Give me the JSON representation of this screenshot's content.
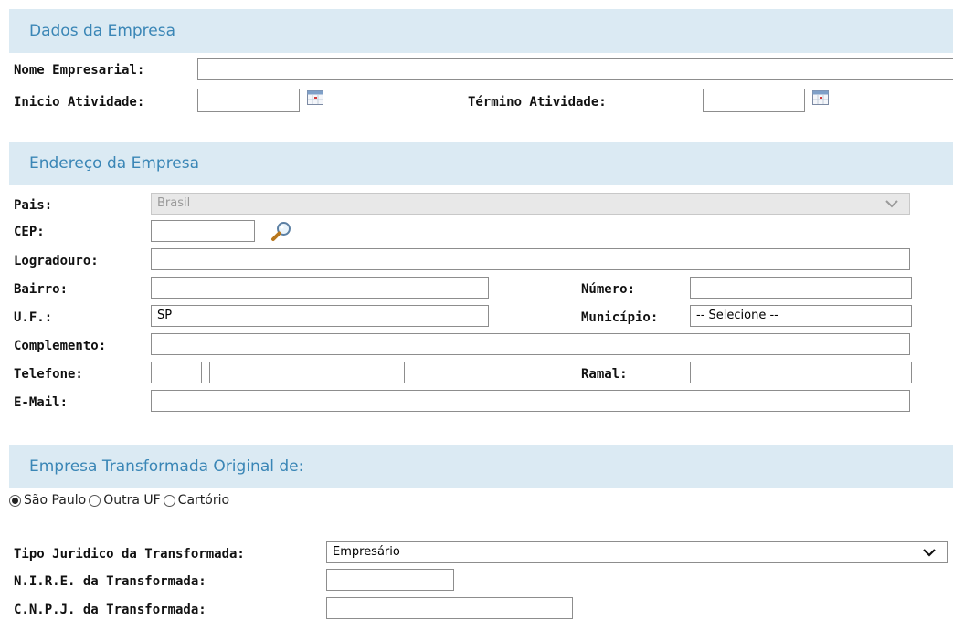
{
  "dados_empresa": {
    "header": "Dados da Empresa",
    "nome_label": "Nome Empresarial:",
    "nome_value": "",
    "inicio_label": "Inicio Atividade:",
    "inicio_value": "",
    "termino_label": "Término Atividade:",
    "termino_value": ""
  },
  "endereco": {
    "header": "Endereço da Empresa",
    "pais_label": "Pais:",
    "pais_value": "Brasil",
    "cep_label": "CEP:",
    "cep_value": "",
    "logradouro_label": "Logradouro:",
    "logradouro_value": "",
    "bairro_label": "Bairro:",
    "bairro_value": "",
    "numero_label": "Número:",
    "numero_value": "",
    "uf_label": "U.F.:",
    "uf_value": "SP",
    "municipio_label": "Município:",
    "municipio_value": "-- Selecione --",
    "complemento_label": "Complemento:",
    "complemento_value": "",
    "telefone_label": "Telefone:",
    "telefone_ddd": "",
    "telefone_numero": "",
    "ramal_label": "Ramal:",
    "ramal_value": "",
    "email_label": "E-Mail:",
    "email_value": ""
  },
  "transformada": {
    "header": "Empresa Transformada Original de:",
    "radio_options": [
      {
        "label": "São Paulo",
        "checked": true
      },
      {
        "label": "Outra UF",
        "checked": false
      },
      {
        "label": "Cartório",
        "checked": false
      }
    ],
    "tipo_label": "Tipo Juridico da Transformada:",
    "tipo_value": "Empresário",
    "nire_label": "N.I.R.E. da Transformada:",
    "nire_value": "",
    "cnpj_label": "C.N.P.J. da Transformada:",
    "cnpj_value": ""
  },
  "icons": {
    "calendar": "calendar-icon",
    "search": "search-icon",
    "chevron": "chevron-down-icon"
  },
  "colors": {
    "section_bg": "#dbeaf3",
    "section_text": "#3a86b6"
  }
}
